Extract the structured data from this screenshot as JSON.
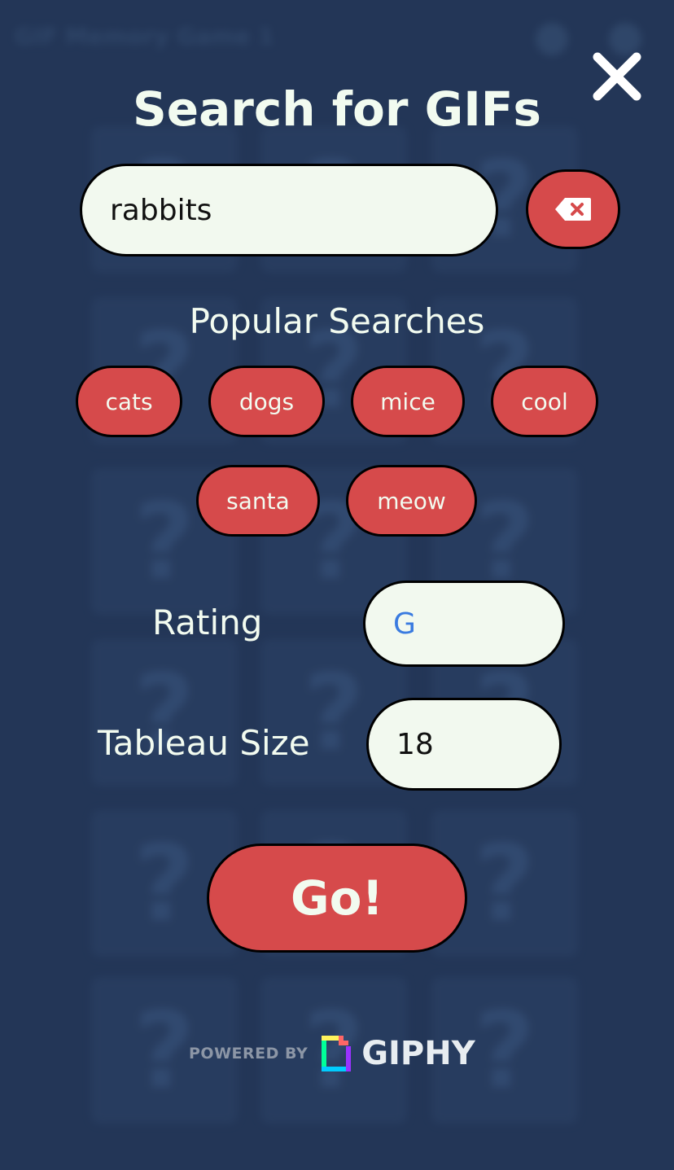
{
  "background": {
    "header_title": "GIF Memory Game 1",
    "card_glyph": "?",
    "card_count": 18
  },
  "modal": {
    "close_icon": "close-icon",
    "title": "Search for GIFs",
    "search": {
      "value": "rabbits",
      "placeholder": ""
    },
    "clear_icon": "backspace-icon",
    "popular_label": "Popular Searches",
    "popular": [
      "cats",
      "dogs",
      "mice",
      "cool",
      "santa",
      "meow"
    ],
    "rating_label": "Rating",
    "rating_value": "G",
    "size_label": "Tableau Size",
    "size_value": "18",
    "go_label": "Go!",
    "powered_by": "POWERED BY",
    "giphy": "GIPHY"
  },
  "colors": {
    "background": "#233657",
    "accent_red": "#d64a4b",
    "input_bg": "#f2f9ef",
    "text_light": "#f2fbf0",
    "rating_blue": "#3a7be0"
  }
}
